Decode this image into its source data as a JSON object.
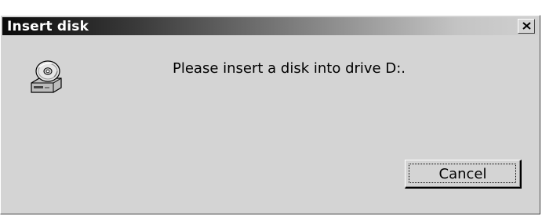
{
  "dialog": {
    "title": "Insert disk",
    "close_symbol": "✕",
    "icon": "cd-drive-icon",
    "message": "Please insert a disk into drive D:.",
    "cancel_label": "Cancel"
  }
}
